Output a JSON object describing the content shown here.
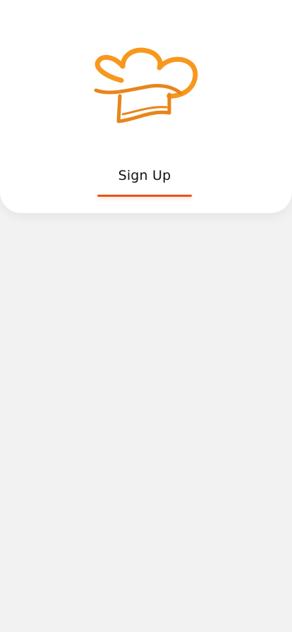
{
  "logo": {
    "icon": "chef-hat-icon",
    "color": "#F7981D",
    "color_dark": "#E8851A"
  },
  "tabs": [
    {
      "label": "Sign Up",
      "active": true
    }
  ],
  "colors": {
    "accent": "#E8541A",
    "background": "#F2F2F2",
    "card": "#FFFFFF"
  }
}
